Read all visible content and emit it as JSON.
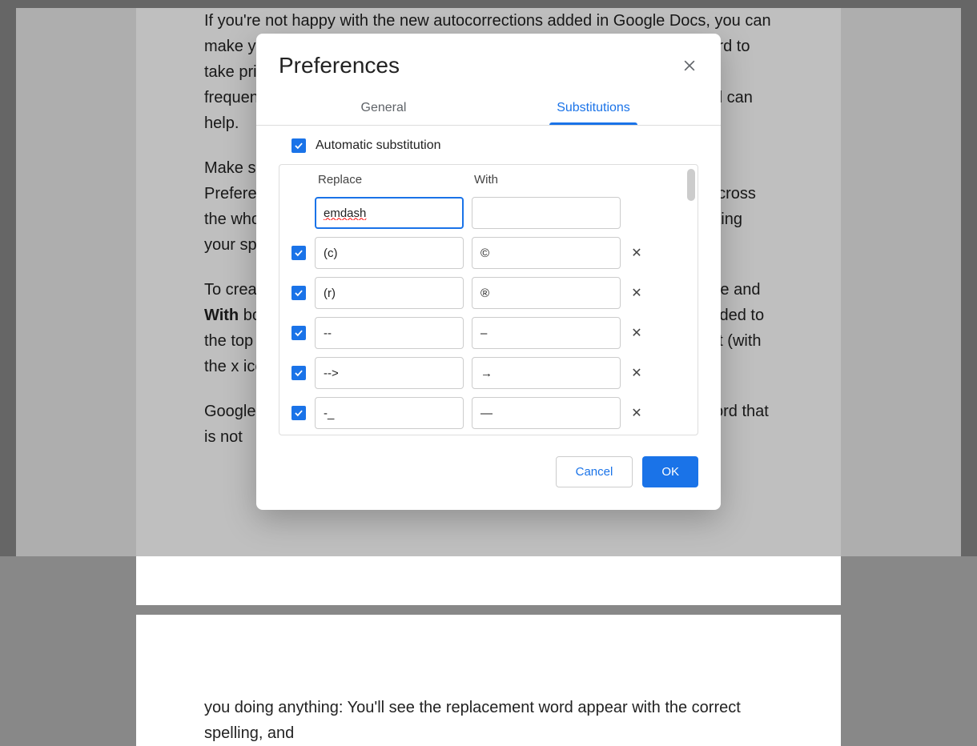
{
  "background": {
    "para1": "If you're not happy with the new autocorrections added in Google Docs, you can make your own customizations and additions. If you want a particular word to take priority on of letters to be replaced by a special character or have a frequently typed phrase on the web, choosing the right words beforehand can help.",
    "para2": "Make sure you're in Google Docs on the web and head to Tools then Preferences. The autocorrect options at the top apply to general words across the whole document. If you don't want Google Docs automatically correcting your spelling, you can click the small x icons on the right of each entry.",
    "para3a": "To create a new substitution entry, type your letters or word in the Replace and",
    "para3b": "With",
    "para3c": "boxes at the top of the list. Your custom substitution entry will be added to the top of the list, where you can turn it off (with the checkbox) or delete it (with the x icon) if the list is looking a bit cluttered.",
    "para4": "Google Docs will then handle these substitutions for you. If you type a word that is not",
    "para5": "you doing anything: You'll see the replacement word appear with the correct spelling, and"
  },
  "modal": {
    "title": "Preferences",
    "tabs": {
      "general": "General",
      "substitutions": "Substitutions"
    },
    "autosub_label": "Automatic substitution",
    "columns": {
      "replace": "Replace",
      "with": "With"
    },
    "rows": [
      {
        "enabled": null,
        "replace": "emdash",
        "with": "",
        "deletable": false,
        "focused": true
      },
      {
        "enabled": true,
        "replace": "(c)",
        "with": "©",
        "deletable": true
      },
      {
        "enabled": true,
        "replace": "(r)",
        "with": "®",
        "deletable": true
      },
      {
        "enabled": true,
        "replace": "--",
        "with": "–",
        "deletable": true
      },
      {
        "enabled": true,
        "replace": "-->",
        "with": "→",
        "deletable": true
      },
      {
        "enabled": true,
        "replace": "-_",
        "with": "—",
        "deletable": true
      }
    ],
    "buttons": {
      "cancel": "Cancel",
      "ok": "OK"
    }
  }
}
